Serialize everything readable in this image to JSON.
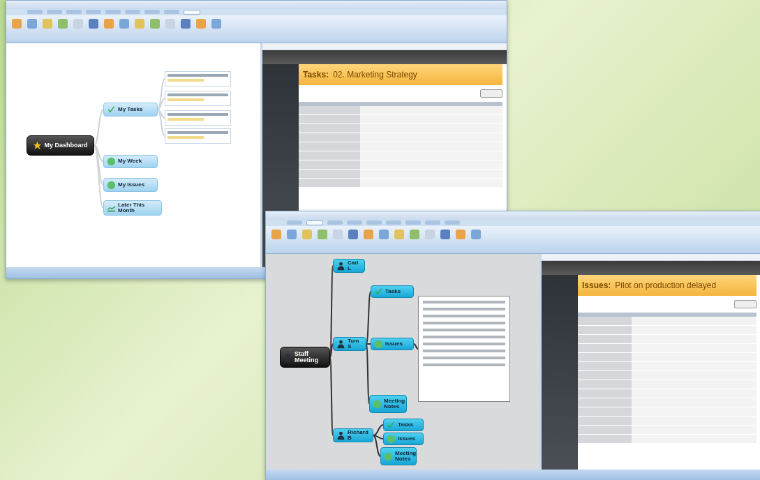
{
  "windows": [
    {
      "map": {
        "label": "My Dashboard",
        "children": [
          {
            "label": "My Tasks",
            "children": [
              {
                "kind": "task-card"
              },
              {
                "kind": "task-card"
              },
              {
                "kind": "task-card"
              },
              {
                "kind": "task-card"
              }
            ]
          },
          {
            "label": "My Week"
          },
          {
            "label": "My Issues"
          },
          {
            "label": "Later This Month"
          }
        ]
      },
      "browser": {
        "category": "Tasks:",
        "title": "02. Marketing Strategy"
      },
      "menu_tabs": [
        {
          "selected": false
        },
        {
          "selected": false
        },
        {
          "selected": false
        },
        {
          "selected": false
        },
        {
          "selected": false
        },
        {
          "selected": false
        },
        {
          "selected": false
        },
        {
          "selected": false
        },
        {
          "selected": true
        }
      ]
    },
    {
      "map": {
        "label": "Staff Meeting",
        "children": [
          {
            "label": "Carl L"
          },
          {
            "label": "Tom S",
            "children": [
              {
                "label": "Tasks"
              },
              {
                "label": "Issues",
                "children": [
                  {
                    "kind": "issue-panel"
                  }
                ]
              },
              {
                "label": "Meeting Notes"
              }
            ]
          },
          {
            "label": "Richard B",
            "children": [
              {
                "label": "Tasks"
              },
              {
                "label": "Issues"
              },
              {
                "label": "Meeting Notes"
              }
            ]
          }
        ]
      },
      "browser": {
        "category": "Issues:",
        "title": "Pilot on production delayed"
      },
      "menu_tabs": [
        {
          "selected": false
        },
        {
          "selected": true
        },
        {
          "selected": false
        },
        {
          "selected": false
        },
        {
          "selected": false
        },
        {
          "selected": false
        },
        {
          "selected": false
        },
        {
          "selected": false
        },
        {
          "selected": false
        }
      ]
    }
  ]
}
